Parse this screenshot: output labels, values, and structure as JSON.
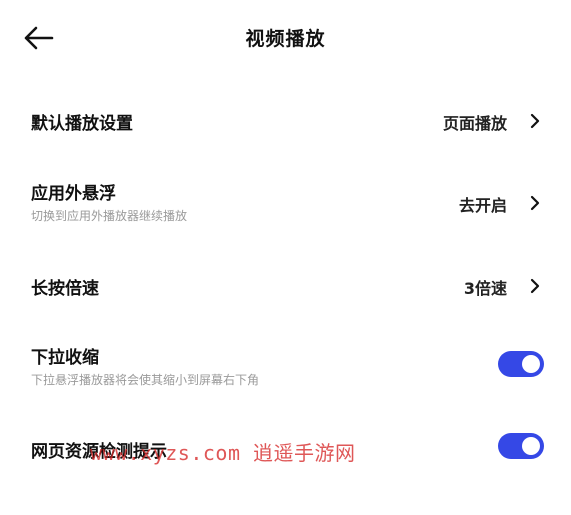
{
  "header": {
    "title": "视频播放",
    "back_icon": "arrow-left-icon"
  },
  "settings": [
    {
      "title": "默认播放设置",
      "value": "页面播放",
      "control": "chevron"
    },
    {
      "title": "应用外悬浮",
      "subtitle": "切换到应用外播放器继续播放",
      "value": "去开启",
      "control": "chevron"
    },
    {
      "title": "长按倍速",
      "value": "3倍速",
      "control": "chevron"
    },
    {
      "title": "下拉收缩",
      "subtitle": "下拉悬浮播放器将会使其缩小到屏幕右下角",
      "control": "toggle",
      "enabled": true
    },
    {
      "title": "网页资源检测提示",
      "control": "toggle",
      "enabled": true
    }
  ],
  "watermark": "www.xyzs.com 逍遥手游网",
  "colors": {
    "accent": "#3548e6",
    "text": "#111111",
    "subtext": "#9a9a9a",
    "watermark": "#d62828"
  }
}
